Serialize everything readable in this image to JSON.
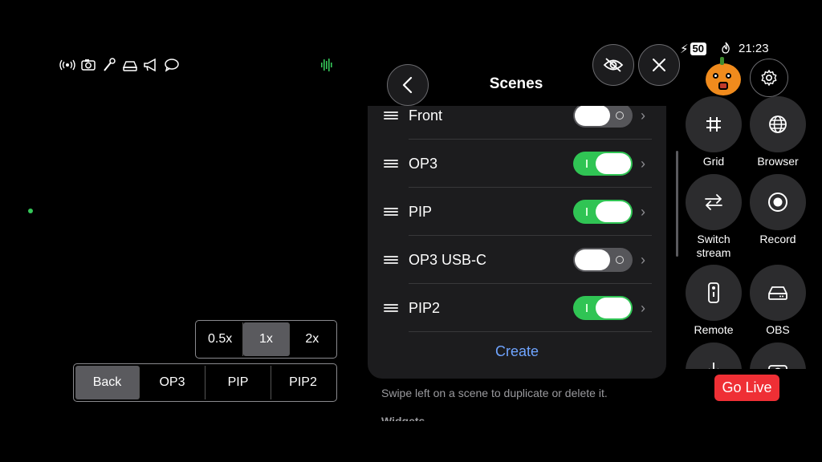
{
  "top_status_icons": [
    "broadcast-icon",
    "camera-icon",
    "microphone-icon",
    "bitrate-icon",
    "megaphone-icon",
    "chat-icon"
  ],
  "zoom": {
    "options": [
      "0.5x",
      "1x",
      "2x"
    ],
    "selected": "1x"
  },
  "scene_buttons": {
    "options": [
      "Back",
      "OP3",
      "PIP",
      "PIP2"
    ],
    "selected": "Back"
  },
  "scenes_panel": {
    "title": "Scenes",
    "scenes": [
      {
        "name": "Front",
        "enabled": false
      },
      {
        "name": "OP3",
        "enabled": true
      },
      {
        "name": "PIP",
        "enabled": true
      },
      {
        "name": "OP3 USB-C",
        "enabled": false
      },
      {
        "name": "PIP2",
        "enabled": true
      }
    ],
    "create_label": "Create",
    "hint": "Swipe left on a scene to duplicate or delete it.",
    "next_section_partial": "Widgets"
  },
  "status_bar": {
    "battery": "50",
    "time": "21:23"
  },
  "quick_buttons": [
    {
      "label": "Grid",
      "icon": "grid-icon"
    },
    {
      "label": "Browser",
      "icon": "globe-icon"
    },
    {
      "label": "Switch stream",
      "icon": "switch-arrows-icon"
    },
    {
      "label": "Record",
      "icon": "record-icon"
    },
    {
      "label": "Remote",
      "icon": "remote-icon"
    },
    {
      "label": "OBS",
      "icon": "obs-icon"
    }
  ],
  "go_live_label": "Go Live",
  "colors": {
    "accent_green": "#30c454",
    "link_blue": "#6fa4ff",
    "live_red": "#ef2f35"
  }
}
